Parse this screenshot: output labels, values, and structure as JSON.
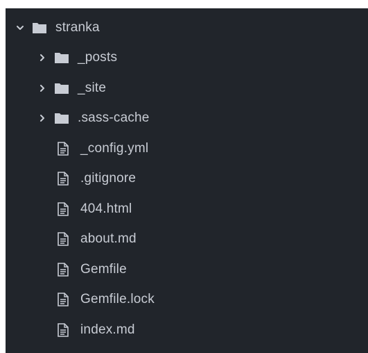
{
  "tree": {
    "root": {
      "label": "stranka",
      "expanded": true,
      "icons": {
        "chevron": "chevron-down-icon",
        "type": "folder-icon"
      }
    },
    "folders": [
      {
        "label": "_posts",
        "expanded": false
      },
      {
        "label": "_site",
        "expanded": false
      },
      {
        "label": ".sass-cache",
        "expanded": false
      }
    ],
    "files": [
      {
        "label": "_config.yml"
      },
      {
        "label": ".gitignore"
      },
      {
        "label": "404.html"
      },
      {
        "label": "about.md"
      },
      {
        "label": "Gemfile"
      },
      {
        "label": "Gemfile.lock"
      },
      {
        "label": "index.md"
      }
    ]
  },
  "colors": {
    "panel_background": "#21252b",
    "text": "#c8ccd4",
    "icon": "#c8ccd4"
  }
}
